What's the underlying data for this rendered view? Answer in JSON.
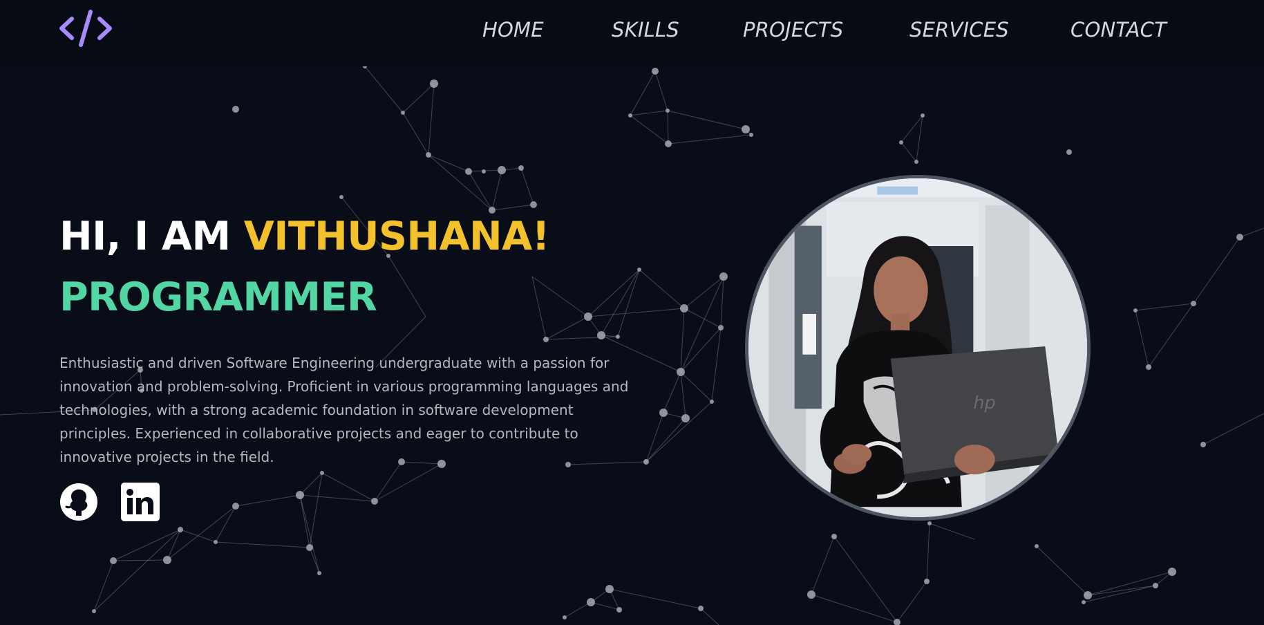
{
  "nav": {
    "logo_icon": "code-brackets-icon",
    "items": [
      "HOME",
      "SKILLS",
      "PROJECTS",
      "SERVICES",
      "CONTACT"
    ]
  },
  "hero": {
    "greeting": "HI, I AM",
    "name": "VITHUSHANA!",
    "role": "PROGRAMMER",
    "description": "Enthusiastic and driven Software Engineering undergraduate with a passion for innovation and problem-solving. Proficient in various programming languages and technologies, with a strong academic foundation in software development principles. Experienced in collaborative projects and eager to contribute to innovative projects in the field."
  },
  "social": [
    {
      "icon": "github-icon"
    },
    {
      "icon": "linkedin-icon"
    }
  ],
  "profile_photo": {
    "icon": "profile-photo-icon"
  },
  "colors": {
    "background": "#090d17",
    "accent_yellow": "#f2c12c",
    "accent_green": "#52d6a3",
    "logo_purple": "#a78bfa",
    "text_light": "#d7d8dc"
  }
}
